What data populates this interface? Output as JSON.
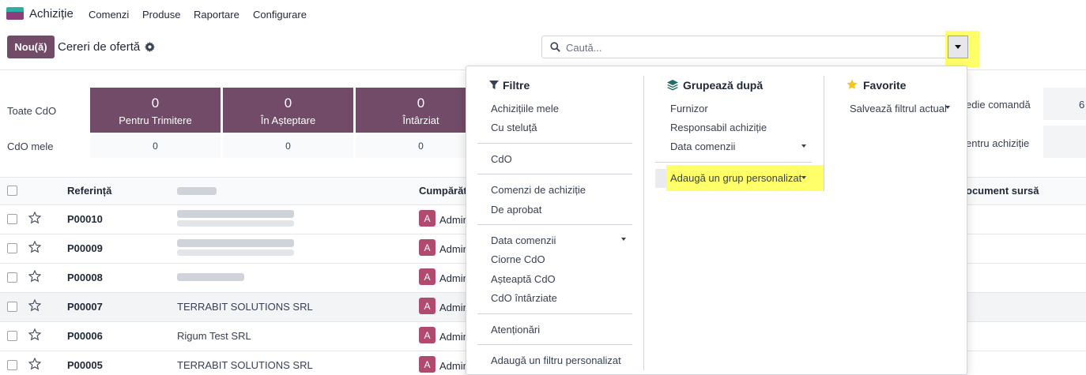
{
  "app": {
    "name": "Achiziție"
  },
  "nav": [
    "Comenzi",
    "Produse",
    "Raportare",
    "Configurare"
  ],
  "control": {
    "new_label": "Nou(ă)",
    "breadcrumb": "Cereri de ofertă",
    "search_placeholder": "Caută..."
  },
  "dashboard": {
    "row_all": "Toate CdO",
    "row_mine": "CdO mele",
    "cards": [
      {
        "value": "0",
        "label": "Pentru Trimitere",
        "mine": "0"
      },
      {
        "value": "0",
        "label": "În Așteptare",
        "mine": "0"
      },
      {
        "value": "0",
        "label": "Întârziat",
        "mine": "0"
      }
    ],
    "right_labels": [
      "edie comandă",
      "entru achiziție"
    ],
    "right_value": "6"
  },
  "table": {
    "headers": {
      "reference": "Referință",
      "buyer": "Cumpărăto",
      "source": "ocument sursă"
    },
    "rows": [
      {
        "ref": "P00010",
        "vendor": "",
        "buyer_initial": "A",
        "buyer": "Admin"
      },
      {
        "ref": "P00009",
        "vendor": "",
        "buyer_initial": "A",
        "buyer": "Admin"
      },
      {
        "ref": "P00008",
        "vendor": "",
        "buyer_initial": "A",
        "buyer": "Admin"
      },
      {
        "ref": "P00007",
        "vendor": "TERRABIT SOLUTIONS SRL",
        "buyer_initial": "A",
        "buyer": "Admin"
      },
      {
        "ref": "P00006",
        "vendor": "Rigum Test SRL",
        "buyer_initial": "A",
        "buyer": "Admin"
      },
      {
        "ref": "P00005",
        "vendor": "TERRABIT SOLUTIONS SRL",
        "buyer_initial": "A",
        "buyer": "Admin"
      }
    ]
  },
  "dropdown": {
    "filters": {
      "title": "Filtre",
      "items": [
        "Achizițiile mele",
        "Cu steluță",
        "CdO",
        "Comenzi de achiziție",
        "De aprobat",
        "Data comenzii",
        "Ciorne CdO",
        "Așteaptă CdO",
        "CdO întârziate",
        "Atenționări",
        "Adaugă un filtru personalizat"
      ]
    },
    "groupby": {
      "title": "Grupează după",
      "items": [
        "Furnizor",
        "Responsabil achiziție",
        "Data comenzii",
        "Adaugă un grup personalizat"
      ]
    },
    "favorites": {
      "title": "Favorite",
      "items": [
        "Salvează filtrul actual"
      ]
    }
  },
  "colors": {
    "brand": "#714b67",
    "highlight": "#ffff6a",
    "avatar": "#b04b6f"
  }
}
